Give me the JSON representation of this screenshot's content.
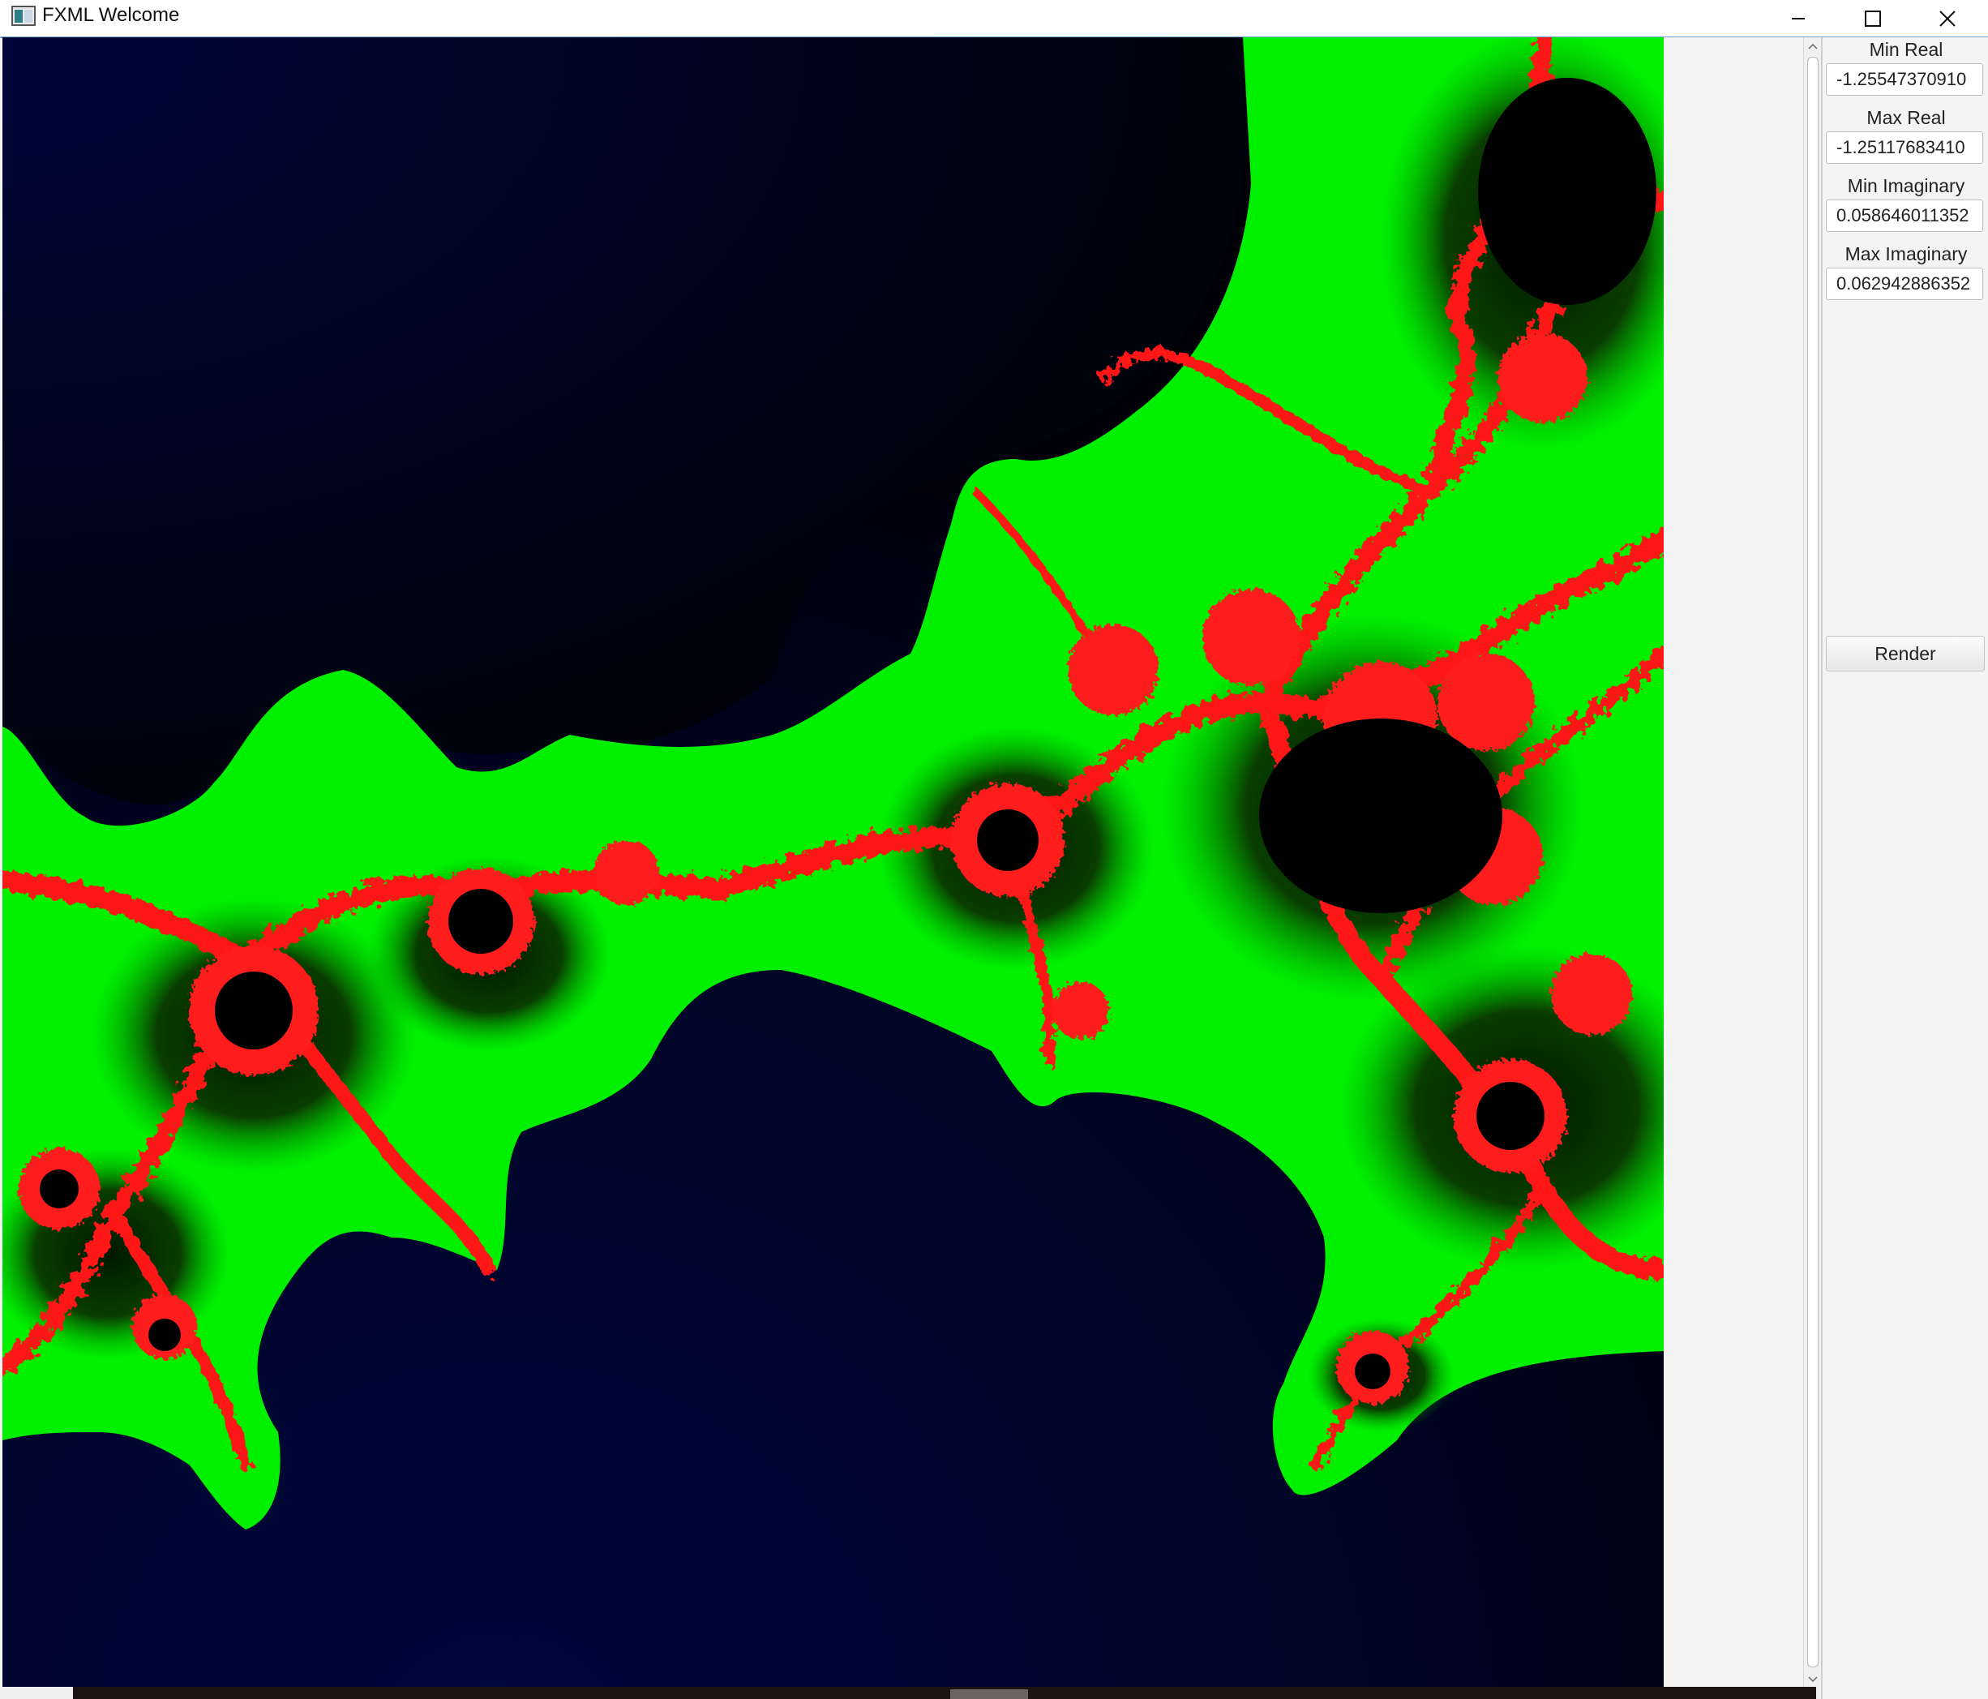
{
  "window": {
    "title": "FXML Welcome",
    "app_icon": "java-window-icon",
    "controls": [
      "minimize-icon",
      "maximize-icon",
      "close-icon"
    ]
  },
  "canvas": {
    "content": "mandelbrot-zoom-render",
    "colors": {
      "outer_background": "#00062a",
      "band_fill": "#00f000",
      "filament": "#ff1010",
      "interior": "#000000"
    }
  },
  "panel": {
    "min_real": {
      "label": "Min Real",
      "value": "-1.25547370910"
    },
    "max_real": {
      "label": "Max Real",
      "value": "-1.25117683410"
    },
    "min_imaginary": {
      "label": "Min Imaginary",
      "value": "0.058646011352"
    },
    "max_imaginary": {
      "label": "Max Imaginary",
      "value": "0.062942886352"
    },
    "render_label": "Render"
  }
}
